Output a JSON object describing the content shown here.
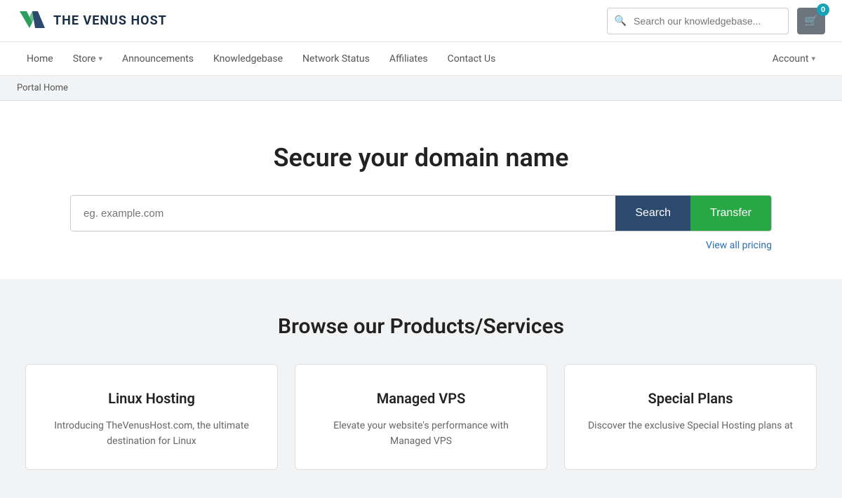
{
  "brand": {
    "name": "THE VENUS HOST",
    "logo_color_primary": "#2c9e5e",
    "logo_color_secondary": "#2c4a6e"
  },
  "search": {
    "placeholder": "Search our knowledgebase..."
  },
  "cart": {
    "count": "0"
  },
  "nav": {
    "items": [
      {
        "label": "Home",
        "has_arrow": false
      },
      {
        "label": "Store",
        "has_arrow": true
      },
      {
        "label": "Announcements",
        "has_arrow": false
      },
      {
        "label": "Knowledgebase",
        "has_arrow": false
      },
      {
        "label": "Network Status",
        "has_arrow": false
      },
      {
        "label": "Affiliates",
        "has_arrow": false
      },
      {
        "label": "Contact Us",
        "has_arrow": false
      }
    ],
    "account_label": "Account"
  },
  "breadcrumb": {
    "label": "Portal Home"
  },
  "hero": {
    "title": "Secure your domain name",
    "search_placeholder": "eg. example.com",
    "search_btn": "Search",
    "transfer_btn": "Transfer",
    "pricing_link": "View all pricing"
  },
  "products": {
    "section_title": "Browse our Products/Services",
    "cards": [
      {
        "title": "Linux Hosting",
        "description": "Introducing TheVenusHost.com, the ultimate destination for Linux"
      },
      {
        "title": "Managed VPS",
        "description": "Elevate your website's performance with Managed VPS"
      },
      {
        "title": "Special Plans",
        "description": "Discover the exclusive Special Hosting plans at"
      }
    ]
  }
}
